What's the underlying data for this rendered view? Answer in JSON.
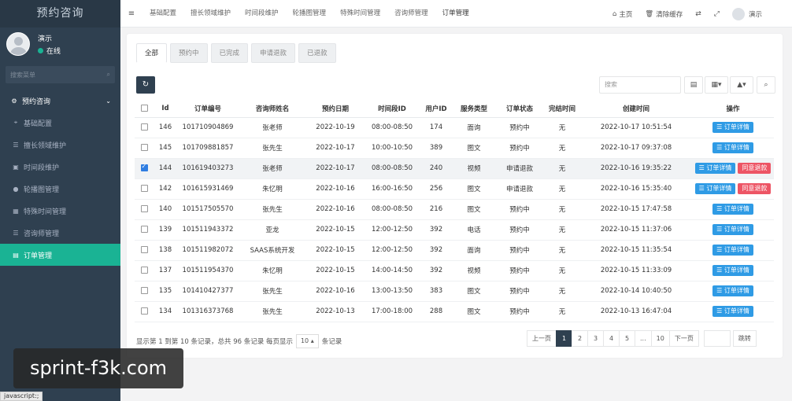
{
  "brand": "预约咨询",
  "user": {
    "name": "演示",
    "status": "在线"
  },
  "side_search_placeholder": "搜索菜单",
  "sidebar": {
    "parent": {
      "label": "预约咨询",
      "icon": "cogs-icon"
    },
    "items": [
      {
        "label": "基础配置",
        "icon": "map-marker-icon",
        "active": false
      },
      {
        "label": "擅长领域维护",
        "icon": "list-icon",
        "active": false
      },
      {
        "label": "时间段维护",
        "icon": "image-icon",
        "active": false
      },
      {
        "label": "轮播图管理",
        "icon": "circle-icon",
        "active": false
      },
      {
        "label": "特殊时间管理",
        "icon": "calendar-icon",
        "active": false
      },
      {
        "label": "咨询师管理",
        "icon": "list-icon",
        "active": false
      },
      {
        "label": "订单管理",
        "icon": "table-icon",
        "active": true
      }
    ]
  },
  "topbar": {
    "tabs": [
      "基础配置",
      "擅长领域维护",
      "时间段维护",
      "轮播图管理",
      "特殊时间管理",
      "咨询师管理",
      "订单管理"
    ],
    "active_tab": "订单管理",
    "home": "主页",
    "clear_cache": "清除缓存",
    "user": "演示"
  },
  "filter_tabs": [
    "全部",
    "预约中",
    "已完成",
    "申请退款",
    "已退款"
  ],
  "search_placeholder": "搜索",
  "columns": [
    "Id",
    "订单编号",
    "咨询师姓名",
    "预约日期",
    "时间段ID",
    "用户ID",
    "服务类型",
    "订单状态",
    "完结时间",
    "创建时间",
    "操作"
  ],
  "rows": [
    {
      "id": "146",
      "order_no": "101710904869",
      "counselor": "张老师",
      "date": "2022-10-19",
      "slot": "08:00-08:50",
      "uid": "174",
      "type": "面询",
      "status": "预约中",
      "status_color": "green",
      "finish": "无",
      "created": "2022-10-17 10:51:54",
      "checked": false,
      "refund": false
    },
    {
      "id": "145",
      "order_no": "101709881857",
      "counselor": "张先生",
      "date": "2022-10-17",
      "slot": "10:00-10:50",
      "uid": "389",
      "type": "图文",
      "status": "预约中",
      "status_color": "green",
      "finish": "无",
      "created": "2022-10-17 09:37:08",
      "checked": false,
      "refund": false
    },
    {
      "id": "144",
      "order_no": "101619403273",
      "counselor": "张老师",
      "date": "2022-10-17",
      "slot": "08:00-08:50",
      "uid": "240",
      "type": "视频",
      "status": "申请退款",
      "status_color": "blue",
      "finish": "无",
      "created": "2022-10-16 19:35:22",
      "checked": true,
      "refund": true
    },
    {
      "id": "142",
      "order_no": "101615931469",
      "counselor": "朱忆明",
      "date": "2022-10-16",
      "slot": "16:00-16:50",
      "uid": "256",
      "type": "图文",
      "status": "申请退款",
      "status_color": "blue",
      "finish": "无",
      "created": "2022-10-16 15:35:40",
      "checked": false,
      "refund": true
    },
    {
      "id": "140",
      "order_no": "101517505570",
      "counselor": "张先生",
      "date": "2022-10-16",
      "slot": "08:00-08:50",
      "uid": "216",
      "type": "图文",
      "status": "预约中",
      "status_color": "green",
      "finish": "无",
      "created": "2022-10-15 17:47:58",
      "checked": false,
      "refund": false
    },
    {
      "id": "139",
      "order_no": "101511943372",
      "counselor": "亚龙",
      "date": "2022-10-15",
      "slot": "12:00-12:50",
      "uid": "392",
      "type": "电话",
      "status": "预约中",
      "status_color": "green",
      "finish": "无",
      "created": "2022-10-15 11:37:06",
      "checked": false,
      "refund": false
    },
    {
      "id": "138",
      "order_no": "101511982072",
      "counselor": "SAAS系统开发",
      "date": "2022-10-15",
      "slot": "12:00-12:50",
      "uid": "392",
      "type": "面询",
      "status": "预约中",
      "status_color": "green",
      "finish": "无",
      "created": "2022-10-15 11:35:54",
      "checked": false,
      "refund": false
    },
    {
      "id": "137",
      "order_no": "101511954370",
      "counselor": "朱忆明",
      "date": "2022-10-15",
      "slot": "14:00-14:50",
      "uid": "392",
      "type": "视频",
      "status": "预约中",
      "status_color": "green",
      "finish": "无",
      "created": "2022-10-15 11:33:09",
      "checked": false,
      "refund": false
    },
    {
      "id": "135",
      "order_no": "101410427377",
      "counselor": "张先生",
      "date": "2022-10-16",
      "slot": "13:00-13:50",
      "uid": "383",
      "type": "图文",
      "status": "预约中",
      "status_color": "green",
      "finish": "无",
      "created": "2022-10-14 10:40:50",
      "checked": false,
      "refund": false
    },
    {
      "id": "134",
      "order_no": "101316373768",
      "counselor": "张先生",
      "date": "2022-10-13",
      "slot": "17:00-18:00",
      "uid": "288",
      "type": "图文",
      "status": "预约中",
      "status_color": "green",
      "finish": "无",
      "created": "2022-10-13 16:47:04",
      "checked": false,
      "refund": false
    }
  ],
  "actions": {
    "detail": "订单详情",
    "refund": "同意退款"
  },
  "footer": {
    "info_prefix": "显示第 1 到第 10 条记录，总共 96 条记录 每页显示",
    "page_size": "10",
    "info_suffix": "条记录"
  },
  "pager": {
    "prev": "上一页",
    "pages": [
      "1",
      "2",
      "3",
      "4",
      "5",
      "...",
      "10"
    ],
    "active": "1",
    "next": "下一页",
    "go": "跳转"
  },
  "watermark": "sprint-f3k.com",
  "statusbar": "javascript:;"
}
